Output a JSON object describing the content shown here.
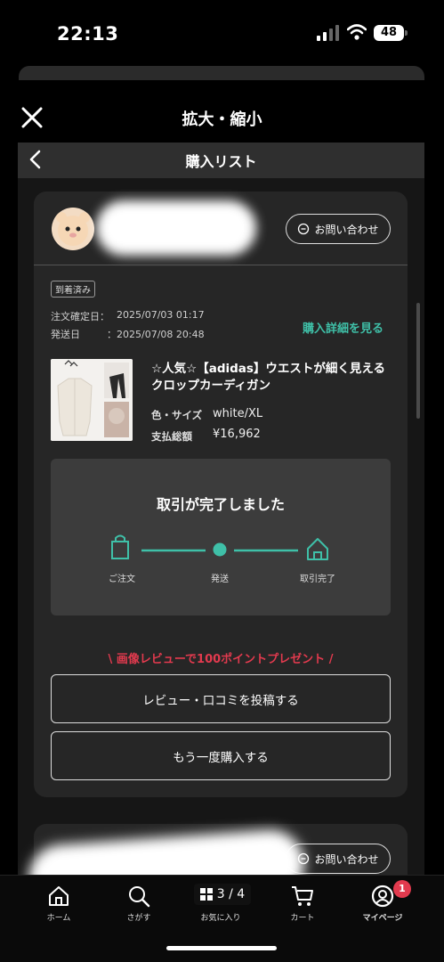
{
  "status_bar": {
    "time": "22:13",
    "battery": "48"
  },
  "viewer": {
    "title": "拡大・縮小"
  },
  "screen": {
    "title": "購入リスト"
  },
  "order": {
    "contact_label": "お問い合わせ",
    "status_badge": "到着済み",
    "confirmed_label": "注文確定日：",
    "confirmed_value": "2025/07/03 01:17",
    "shipped_label": "発送日",
    "shipped_value": "：2025/07/08 20:48",
    "detail_link": "購入詳細を見る",
    "product_name": "☆人気☆【adidas】ウエストが細く見えるクロップカーディガン",
    "color_size_label": "色・サイズ",
    "color_size_value": "white/XL",
    "total_label": "支払総額",
    "total_value": "¥16,962",
    "progress_title": "取引が完了しました",
    "steps": [
      "ご注文",
      "発送",
      "取引完了"
    ],
    "promo": "\\ 画像レビューで100ポイントプレゼント /",
    "review_button": "レビュー・口コミを投稿する",
    "rebuy_button": "もう一度購入する"
  },
  "order2": {
    "contact_label": "お問い合わせ"
  },
  "page_indicator": "3 / 4",
  "tabs": [
    {
      "label": "ホーム",
      "icon": "home-icon"
    },
    {
      "label": "さがす",
      "icon": "search-icon"
    },
    {
      "label": "お気に入り",
      "icon": "favorite-icon"
    },
    {
      "label": "カート",
      "icon": "cart-icon"
    },
    {
      "label": "マイページ",
      "icon": "mypage-icon"
    }
  ],
  "notification_count": "1",
  "colors": {
    "accent": "#3fc0a8",
    "promo": "#e23a4e",
    "card": "#262626",
    "badge": "#e23a4e"
  }
}
